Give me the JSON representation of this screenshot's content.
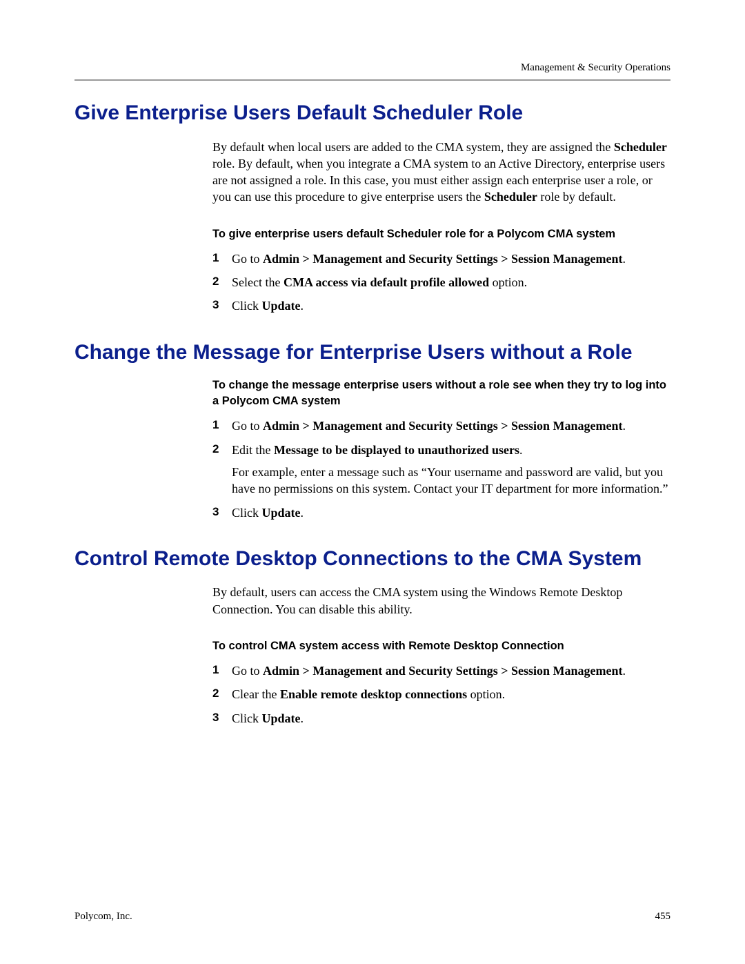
{
  "header": {
    "right": "Management & Security Operations"
  },
  "section1": {
    "title": "Give Enterprise Users Default Scheduler Role",
    "intro_pre": "By default when local users are added to the CMA system, they are assigned the ",
    "intro_bold1": "Scheduler",
    "intro_mid": " role. By default, when you integrate a CMA system to an Active Directory, enterprise users are not assigned a role. In this case, you must either assign each enterprise user a role, or you can use this procedure to give enterprise users the ",
    "intro_bold2": "Scheduler",
    "intro_post": " role by default.",
    "sub": "To give enterprise users default Scheduler role for a Polycom CMA system",
    "step1_pre": "Go to ",
    "step1_bold": "Admin > Management and Security Settings > Session Management",
    "step1_post": ".",
    "step2_pre": "Select the ",
    "step2_bold": "CMA access via default profile allowed",
    "step2_post": " option.",
    "step3_pre": "Click ",
    "step3_bold": "Update",
    "step3_post": "."
  },
  "section2": {
    "title": "Change the Message for Enterprise Users without a Role",
    "sub": "To change the message enterprise users without a role see when they try to log into a Polycom CMA system",
    "step1_pre": "Go to ",
    "step1_bold": "Admin > Management and Security Settings > Session Management",
    "step1_post": ".",
    "step2_pre": "Edit the ",
    "step2_bold": "Message to be displayed to unauthorized users",
    "step2_post": ".",
    "step2_extra": "For example, enter a message such as “Your username and password are valid, but you have no permissions on this system. Contact your IT department for more information.”",
    "step3_pre": "Click ",
    "step3_bold": "Update",
    "step3_post": "."
  },
  "section3": {
    "title": "Control Remote Desktop Connections to the CMA System",
    "intro": "By default, users can access the CMA system using the Windows Remote Desktop Connection. You can disable this ability.",
    "sub": "To control CMA system access with Remote Desktop Connection",
    "step1_pre": "Go to ",
    "step1_bold": "Admin > Management and Security Settings > Session Management",
    "step1_post": ".",
    "step2_pre": "Clear the ",
    "step2_bold": "Enable remote desktop connections",
    "step2_post": " option.",
    "step3_pre": "Click ",
    "step3_bold": "Update",
    "step3_post": "."
  },
  "nums": {
    "n1": "1",
    "n2": "2",
    "n3": "3"
  },
  "footer": {
    "left": "Polycom, Inc.",
    "right": "455"
  }
}
